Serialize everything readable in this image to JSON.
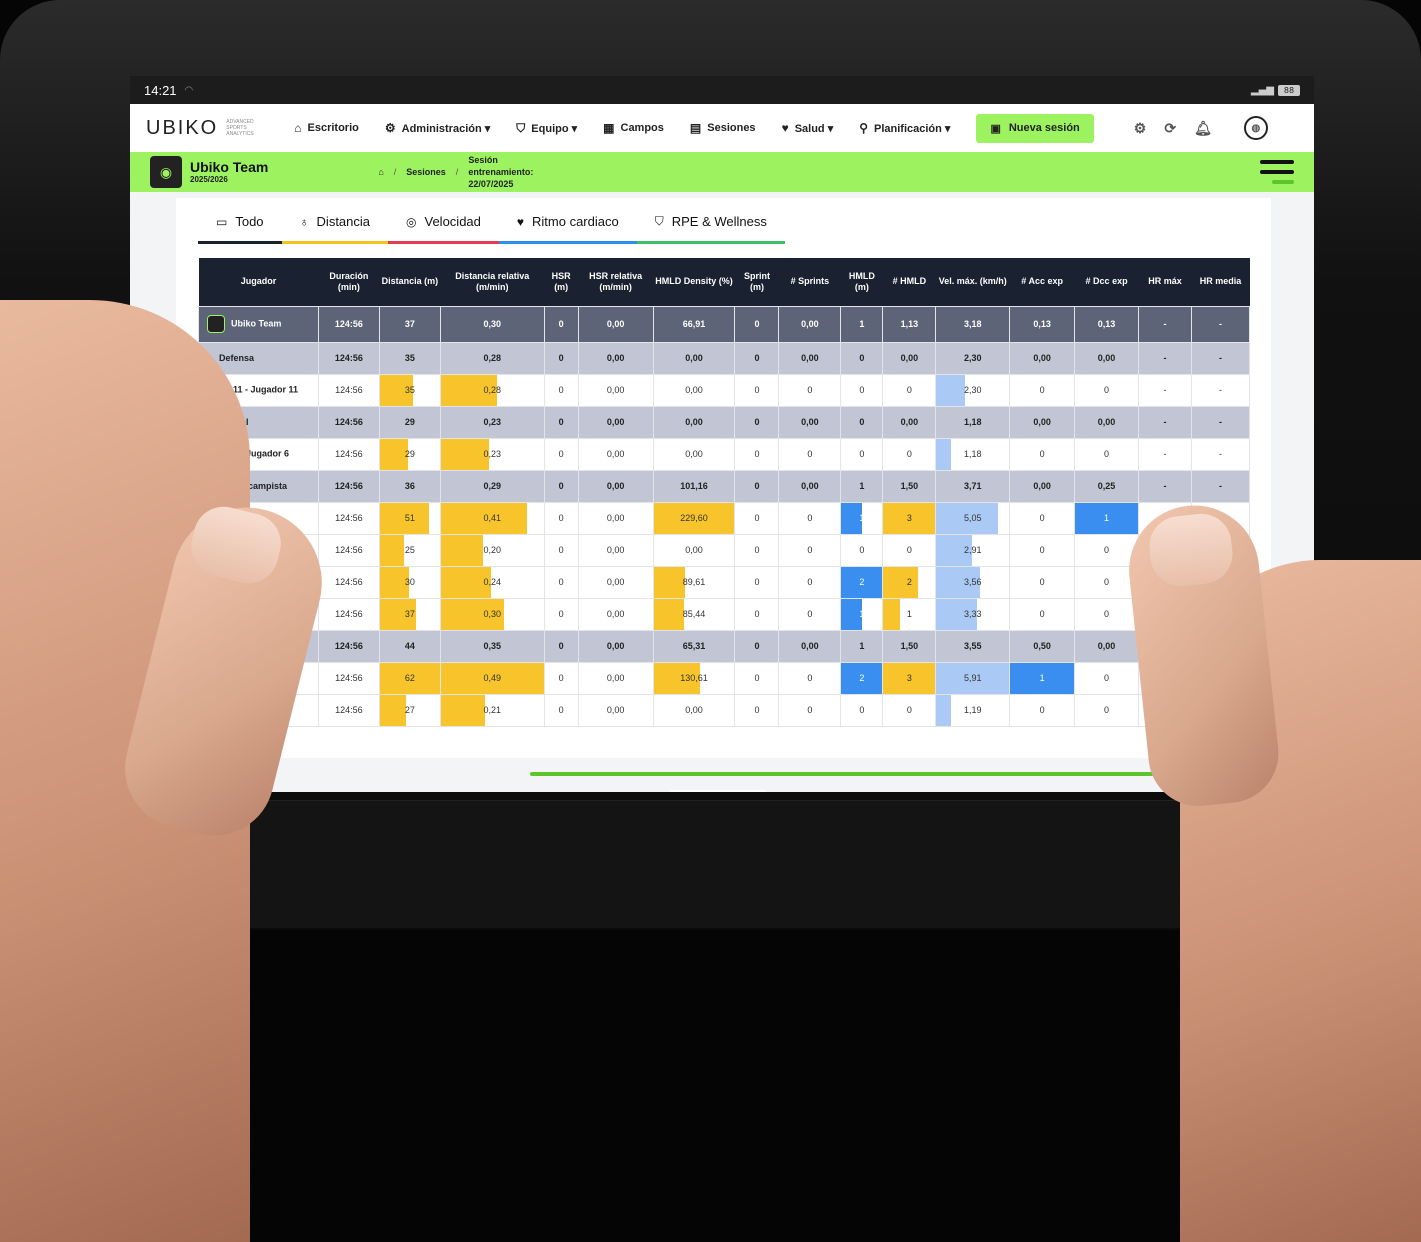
{
  "status": {
    "time": "14:21",
    "battery": "88"
  },
  "nav": {
    "logo": "UBIKO",
    "logo_sub": "ADVANCED SPORTS ANALYTICS",
    "items": [
      {
        "label": "Escritorio",
        "icon": "home-icon"
      },
      {
        "label": "Administración ▾",
        "icon": "gear-icon"
      },
      {
        "label": "Equipo ▾",
        "icon": "shield-icon"
      },
      {
        "label": "Campos",
        "icon": "map-icon"
      },
      {
        "label": "Sesiones",
        "icon": "calendar-icon"
      },
      {
        "label": "Salud ▾",
        "icon": "heart-icon"
      },
      {
        "label": "Planificación ▾",
        "icon": "runner-icon"
      }
    ],
    "new_session": "Nueva sesión"
  },
  "team": {
    "name": "Ubiko Team",
    "season": "2025/2026",
    "breadcrumb_sessions": "Sesiones",
    "breadcrumb_session_l1": "Sesión",
    "breadcrumb_session_l2": "entrenamiento:",
    "breadcrumb_session_l3": "22/07/2025"
  },
  "tabs": [
    {
      "label": "Todo",
      "icon": "table-icon",
      "color": "#1a2130"
    },
    {
      "label": "Distancia",
      "icon": "pin-icon",
      "color": "#f5c320"
    },
    {
      "label": "Velocidad",
      "icon": "speedometer-icon",
      "color": "#e83a4f"
    },
    {
      "label": "Ritmo cardiaco",
      "icon": "heartbeat-icon",
      "color": "#2f8ee8"
    },
    {
      "label": "RPE & Wellness",
      "icon": "shield-heart-icon",
      "color": "#3cc06a"
    }
  ],
  "table": {
    "headers": [
      "Jugador",
      "Duración (min)",
      "Distancia (m)",
      "Distancia relativa (m/min)",
      "HSR (m)",
      "HSR relativa (m/min)",
      "HMLD Density (%)",
      "Sprint (m)",
      "# Sprints",
      "HMLD (m)",
      "# HMLD",
      "Vel. máx. (km/h)",
      "# Acc exp",
      "# Dcc exp",
      "HR máx",
      "HR media"
    ],
    "rows": [
      {
        "type": "team",
        "name": "Ubiko Team",
        "cells": [
          "124:56",
          "37",
          "0,30",
          "0",
          "0,00",
          "66,91",
          "0",
          "0,00",
          "1",
          "1,13",
          "3,18",
          "0,13",
          "0,13",
          "-",
          "-"
        ]
      },
      {
        "type": "group",
        "name": "Defensa",
        "cells": [
          "124:56",
          "35",
          "0,28",
          "0",
          "0,00",
          "0,00",
          "0",
          "0,00",
          "0",
          "0,00",
          "2,30",
          "0,00",
          "0,00",
          "-",
          "-"
        ]
      },
      {
        "type": "player",
        "name": "11 - Jugador 11",
        "cells": [
          "124:56",
          "35",
          "0,28",
          "0",
          "0,00",
          "0,00",
          "0",
          "0",
          "0",
          "0",
          "2,30",
          "0",
          "0",
          "-",
          "-"
        ],
        "bars": {
          "2": 0.56,
          "3": 0.55,
          "11": 0.39
        }
      },
      {
        "type": "group",
        "name": "Lateral",
        "cells": [
          "124:56",
          "29",
          "0,23",
          "0",
          "0,00",
          "0,00",
          "0",
          "0,00",
          "0",
          "0,00",
          "1,18",
          "0,00",
          "0,00",
          "-",
          "-"
        ]
      },
      {
        "type": "player",
        "name": "6 - Jugador 6",
        "cells": [
          "124:56",
          "29",
          "0,23",
          "0",
          "0,00",
          "0,00",
          "0",
          "0",
          "0",
          "0",
          "1,18",
          "0",
          "0",
          "-",
          "-"
        ],
        "bars": {
          "2": 0.47,
          "3": 0.47,
          "11": 0.2
        }
      },
      {
        "type": "group",
        "name": "Centrocampista",
        "cells": [
          "124:56",
          "36",
          "0,29",
          "0",
          "0,00",
          "101,16",
          "0",
          "0,00",
          "1",
          "1,50",
          "3,71",
          "0,00",
          "0,25",
          "-",
          "-"
        ]
      },
      {
        "type": "player",
        "name": "dor 2",
        "cells": [
          "124:56",
          "51",
          "0,41",
          "0",
          "0,00",
          "229,60",
          "0",
          "0",
          "1",
          "3",
          "5,05",
          "0",
          "1",
          "",
          ""
        ],
        "bars": {
          "2": 0.82,
          "3": 0.84,
          "6": 1.0,
          "9": 0.5,
          "10": 1.0,
          "11": 0.85,
          "13": 1.0
        }
      },
      {
        "type": "player",
        "name": "10",
        "cells": [
          "124:56",
          "25",
          "0,20",
          "0",
          "0,00",
          "0,00",
          "0",
          "0",
          "0",
          "0",
          "2,91",
          "0",
          "0",
          "",
          ""
        ],
        "bars": {
          "2": 0.4,
          "3": 0.41,
          "11": 0.49
        }
      },
      {
        "type": "player",
        "name": "14",
        "cells": [
          "124:56",
          "30",
          "0,24",
          "0",
          "0,00",
          "89,61",
          "0",
          "0",
          "2",
          "2",
          "3,56",
          "0",
          "0",
          "",
          ""
        ],
        "bars": {
          "2": 0.48,
          "3": 0.49,
          "6": 0.39,
          "9": 1.0,
          "10": 0.67,
          "11": 0.6
        }
      },
      {
        "type": "player",
        "name": "r 28",
        "cells": [
          "124:56",
          "37",
          "0,30",
          "0",
          "0,00",
          "85,44",
          "0",
          "0",
          "1",
          "1",
          "3,33",
          "0",
          "0",
          "",
          ""
        ],
        "bars": {
          "2": 0.6,
          "3": 0.61,
          "6": 0.37,
          "9": 0.5,
          "10": 0.33,
          "11": 0.56
        }
      },
      {
        "type": "group",
        "name": "",
        "cells": [
          "124:56",
          "44",
          "0,35",
          "0",
          "0,00",
          "65,31",
          "0",
          "0,00",
          "1",
          "1,50",
          "3,55",
          "0,50",
          "0,00",
          "",
          ""
        ]
      },
      {
        "type": "player",
        "name": "ador 25",
        "cells": [
          "124:56",
          "62",
          "0,49",
          "0",
          "0,00",
          "130,61",
          "0",
          "0",
          "2",
          "3",
          "5,91",
          "1",
          "0",
          "",
          ""
        ],
        "bars": {
          "2": 1.0,
          "3": 1.0,
          "6": 0.57,
          "9": 1.0,
          "10": 1.0,
          "11": 1.0,
          "12": 1.0
        }
      },
      {
        "type": "player",
        "name": "ugador 29",
        "cells": [
          "124:56",
          "27",
          "0,21",
          "0",
          "0,00",
          "0,00",
          "0",
          "0",
          "0",
          "0",
          "1,19",
          "0",
          "0",
          "-",
          ""
        ],
        "bars": {
          "2": 0.43,
          "3": 0.43,
          "11": 0.2
        }
      }
    ]
  },
  "colors": {
    "accent": "#9cf35f",
    "bar_yellow": "#f7c52b",
    "bar_blue": "#3a8ef0",
    "bar_light_blue": "#aacaf5"
  }
}
